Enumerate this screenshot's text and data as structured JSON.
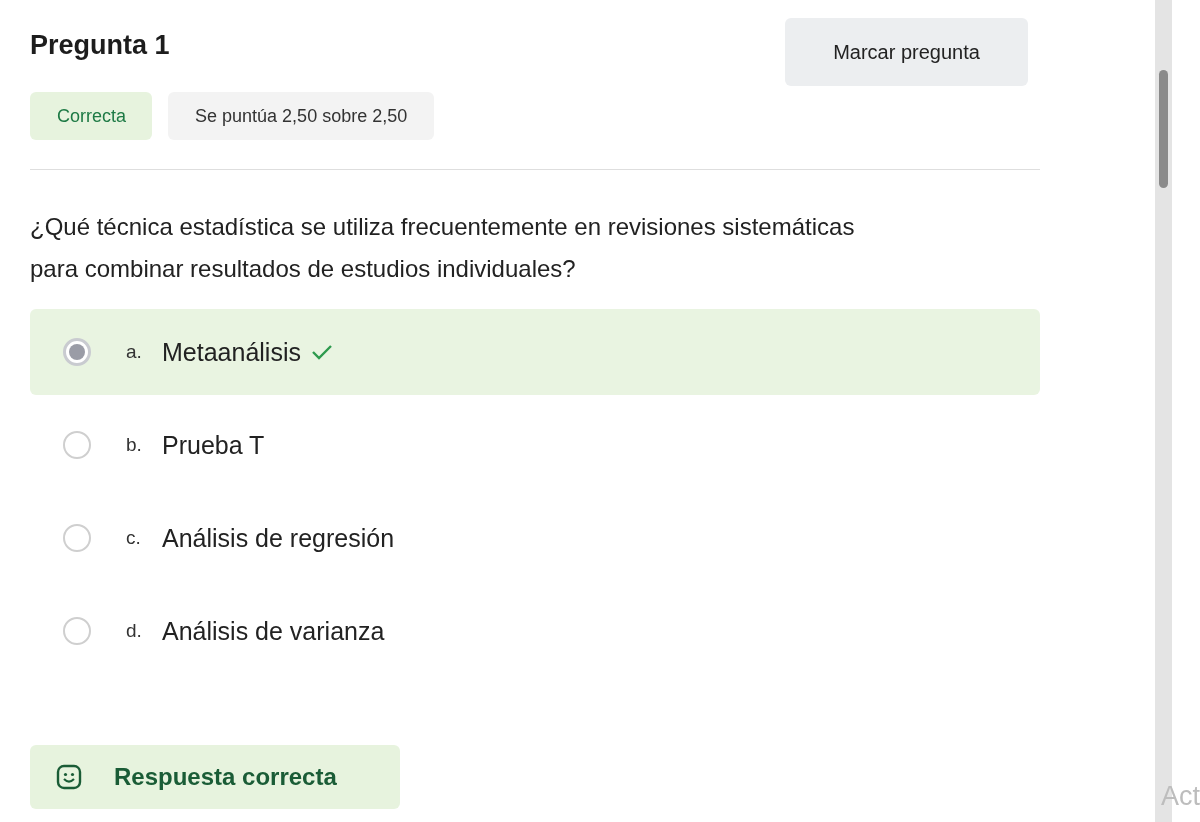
{
  "question": {
    "title": "Pregunta 1",
    "flag_button": "Marcar pregunta",
    "status": {
      "label": "Correcta",
      "kind": "correct"
    },
    "grade": "Se puntúa 2,50 sobre 2,50",
    "text": "¿Qué técnica estadística se utiliza frecuentemente en revisiones sistemáticas para combinar resultados de estudios individuales?",
    "options": [
      {
        "letter": "a.",
        "label": "Metaanálisis",
        "selected": true,
        "correct": true
      },
      {
        "letter": "b.",
        "label": "Prueba T",
        "selected": false,
        "correct": false
      },
      {
        "letter": "c.",
        "label": "Análisis de regresión",
        "selected": false,
        "correct": false
      },
      {
        "letter": "d.",
        "label": "Análisis de varianza",
        "selected": false,
        "correct": false
      }
    ],
    "feedback": {
      "text": "Respuesta correcta",
      "kind": "correct"
    }
  },
  "os_overlay": {
    "text": "Act"
  }
}
